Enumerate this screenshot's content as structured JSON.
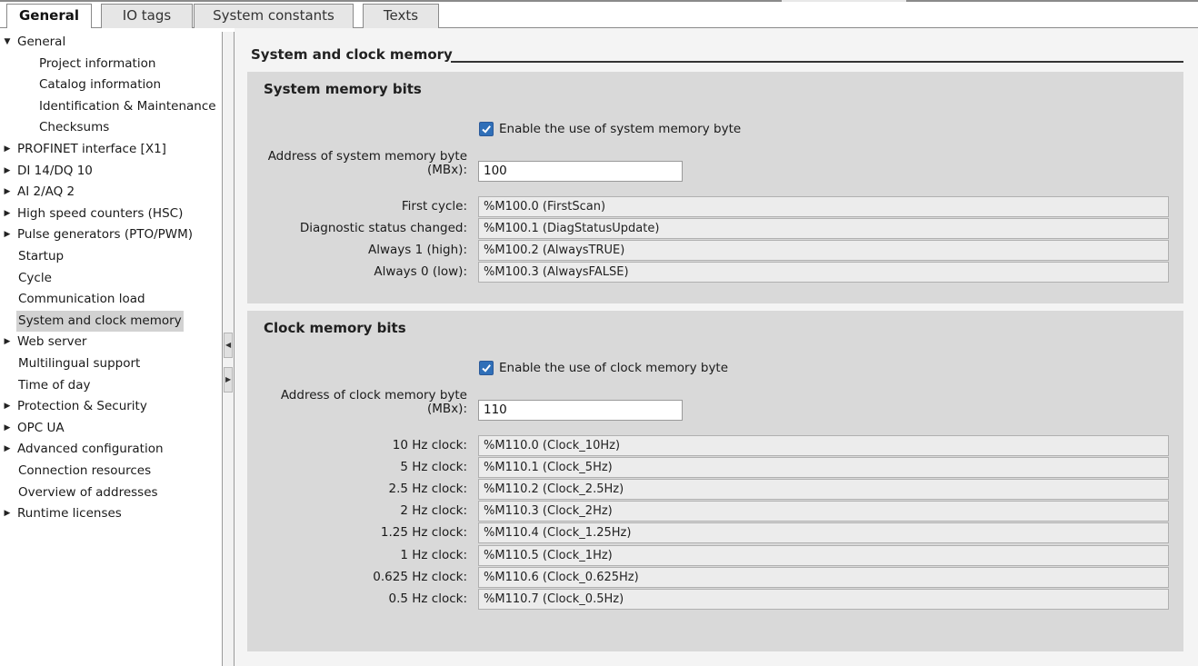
{
  "tabs": [
    {
      "label": "General",
      "active": true
    },
    {
      "label": "IO tags",
      "active": false
    },
    {
      "label": "System constants",
      "active": false
    },
    {
      "label": "Texts",
      "active": false
    }
  ],
  "nav": {
    "items": [
      {
        "label": "General",
        "expander": "expanded"
      },
      {
        "label": "Project information",
        "expander": "none"
      },
      {
        "label": "Catalog information",
        "expander": "none"
      },
      {
        "label": "Identification & Maintenance",
        "expander": "none"
      },
      {
        "label": "Checksums",
        "expander": "none"
      },
      {
        "label": "PROFINET interface [X1]",
        "expander": "collapsed"
      },
      {
        "label": "DI 14/DQ 10",
        "expander": "collapsed"
      },
      {
        "label": "AI 2/AQ 2",
        "expander": "collapsed"
      },
      {
        "label": "High speed counters (HSC)",
        "expander": "collapsed"
      },
      {
        "label": "Pulse generators (PTO/PWM)",
        "expander": "collapsed"
      },
      {
        "label": "Startup",
        "expander": "none"
      },
      {
        "label": "Cycle",
        "expander": "none"
      },
      {
        "label": "Communication load",
        "expander": "none"
      },
      {
        "label": "System and clock memory",
        "expander": "none",
        "selected": true
      },
      {
        "label": "Web server",
        "expander": "collapsed"
      },
      {
        "label": "Multilingual support",
        "expander": "none"
      },
      {
        "label": "Time of day",
        "expander": "none"
      },
      {
        "label": "Protection & Security",
        "expander": "collapsed"
      },
      {
        "label": "OPC UA",
        "expander": "collapsed"
      },
      {
        "label": "Advanced configuration",
        "expander": "collapsed"
      },
      {
        "label": "Connection resources",
        "expander": "none"
      },
      {
        "label": "Overview of addresses",
        "expander": "none"
      },
      {
        "label": "Runtime licenses",
        "expander": "collapsed"
      }
    ]
  },
  "main": {
    "title": "System and clock memory",
    "system": {
      "title": "System memory bits",
      "enable_label": "Enable the use of system memory byte",
      "enabled": true,
      "address_label_line1": "Address of system memory byte",
      "address_label_line2": "(MBx):",
      "address_value": "100",
      "bits": [
        {
          "label": "First cycle:",
          "value": "%M100.0 (FirstScan)"
        },
        {
          "label": "Diagnostic status changed:",
          "value": "%M100.1 (DiagStatusUpdate)"
        },
        {
          "label": "Always 1 (high):",
          "value": "%M100.2 (AlwaysTRUE)"
        },
        {
          "label": "Always 0 (low):",
          "value": "%M100.3 (AlwaysFALSE)"
        }
      ]
    },
    "clock": {
      "title": "Clock memory bits",
      "enable_label": "Enable the use of clock memory byte",
      "enabled": true,
      "address_label_line1": "Address of clock memory byte",
      "address_label_line2": "(MBx):",
      "address_value": "110",
      "bits": [
        {
          "label": "10 Hz clock:",
          "value": "%M110.0 (Clock_10Hz)"
        },
        {
          "label": "5 Hz clock:",
          "value": "%M110.1 (Clock_5Hz)"
        },
        {
          "label": "2.5 Hz clock:",
          "value": "%M110.2 (Clock_2.5Hz)"
        },
        {
          "label": "2 Hz clock:",
          "value": "%M110.3 (Clock_2Hz)"
        },
        {
          "label": "1.25 Hz clock:",
          "value": "%M110.4 (Clock_1.25Hz)"
        },
        {
          "label": "1 Hz clock:",
          "value": "%M110.5 (Clock_1Hz)"
        },
        {
          "label": "0.625 Hz clock:",
          "value": "%M110.6 (Clock_0.625Hz)"
        },
        {
          "label": "0.5 Hz clock:",
          "value": "%M110.7 (Clock_0.5Hz)"
        }
      ]
    }
  },
  "icons": {
    "expanded": "triangle-down-icon",
    "collapsed": "triangle-right-icon",
    "checkbox": "checkmark-icon",
    "splitter_left": "collapse-left-icon",
    "splitter_right": "expand-right-icon"
  },
  "colors": {
    "selected_nav": "#d2d2d2",
    "group_background": "#d9d9d9",
    "checkbox_fill": "#2f6fb8"
  }
}
